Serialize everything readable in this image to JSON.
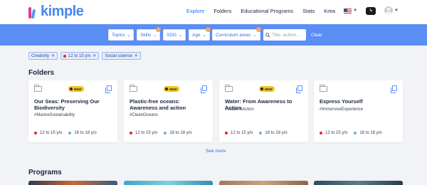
{
  "header": {
    "logo_text": "kimple",
    "nav": [
      "Explore",
      "Folders",
      "Educational Programs",
      "Stats",
      "Krea"
    ],
    "active_nav": "Explore",
    "dark_button_icon": "lightning-icon"
  },
  "filters": {
    "buttons": [
      {
        "label": "Topics",
        "badge": ""
      },
      {
        "label": "Skills",
        "badge": "1"
      },
      {
        "label": "SDG",
        "badge": ""
      },
      {
        "label": "Age",
        "badge": "1"
      },
      {
        "label": "Curriculum areas",
        "badge": "1"
      }
    ],
    "search_placeholder": "Title, author,...",
    "clear_label": "Clear"
  },
  "active_chips": [
    "Creativity",
    "12 to 15 y/o",
    "Social science"
  ],
  "sections": {
    "folders_title": "Folders",
    "programs_title": "Programs",
    "see_more": "See more"
  },
  "folders": [
    {
      "title": "Our Seas: Preserving Our Biodiversity",
      "tag": "#MarineSustainability",
      "new_label": "NEW",
      "age1": "12 to 15 y/o",
      "age2": "16 to 18 y/o"
    },
    {
      "title": "Plastic-free oceans: Awareness and action",
      "tag": "#CleanOceans",
      "new_label": "NEW",
      "age1": "12 to 15 y/o",
      "age2": "16 to 18 y/o"
    },
    {
      "title": "Water: From Awareness to Action",
      "tag": "#WaterInAction",
      "new_label": "NEW",
      "age1": "12 to 15 y/o",
      "age2": "16 to 18 y/o"
    },
    {
      "title": "Express Yourself",
      "tag": "#ImmersiveExperience",
      "new_label": "",
      "age1": "12 to 15 y/o",
      "age2": "16 to 18 y/o"
    }
  ],
  "colors": {
    "accent": "#2f6ee8",
    "filter_bar": "#5b8ef3",
    "new_badge": "#f4c51a",
    "age_red": "#e2262f",
    "age_blue": "#56b6e9"
  }
}
